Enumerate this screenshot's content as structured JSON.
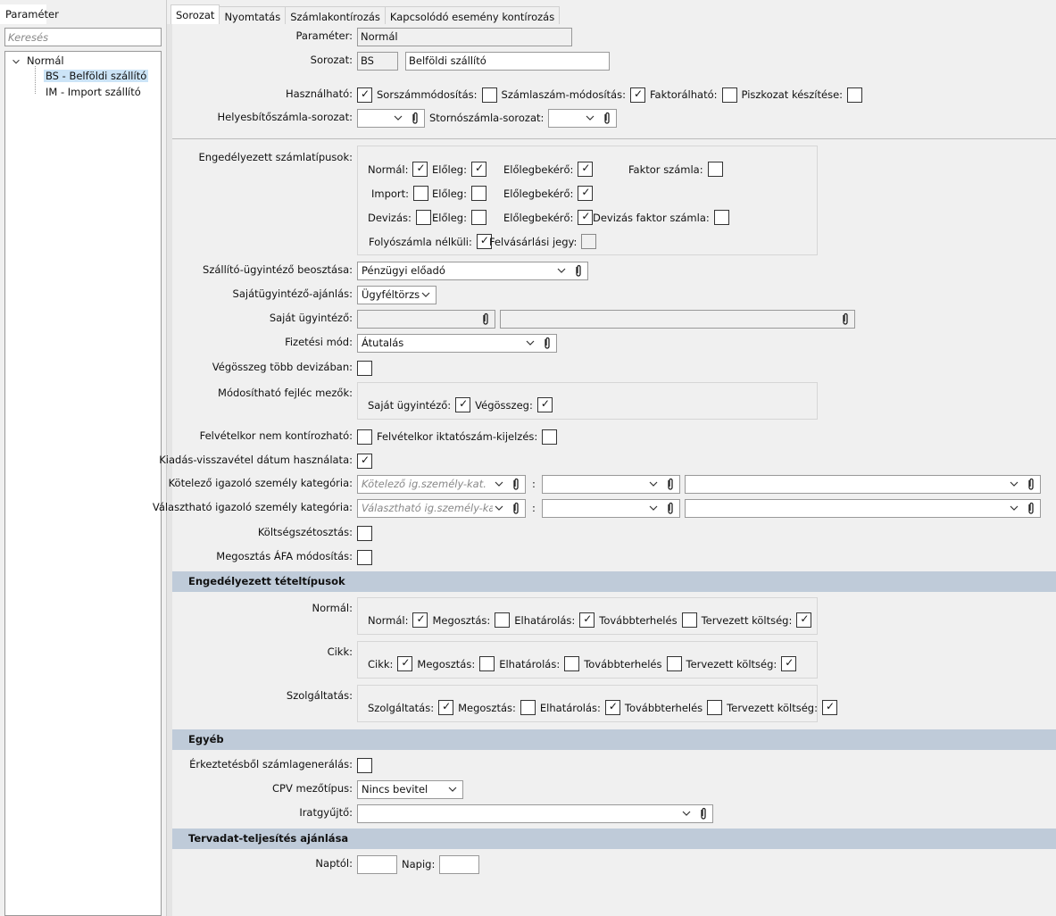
{
  "left": {
    "tab": "Paraméter",
    "search_placeholder": "Keresés",
    "tree": {
      "root": "Normál",
      "items": [
        "BS - Belföldi szállító",
        "IM - Import szállító"
      ]
    }
  },
  "tabs": [
    "Sorozat",
    "Nyomtatás",
    "Számlakontírozás",
    "Kapcsolódó esemény kontírozás"
  ],
  "form": {
    "parameter": {
      "label": "Paraméter:",
      "value": "Normál"
    },
    "sorozat": {
      "label": "Sorozat:",
      "code": "BS",
      "name": "Belföldi szállító"
    },
    "flags": {
      "label": "Használható:",
      "hasznalhato": true,
      "sorszam_label": "Sorszámmódosítás:",
      "sorszam": false,
      "szamlaszam_label": "Számlaszám-módosítás:",
      "szamlaszam": true,
      "faktor_label": "Faktorálható:",
      "faktor": false,
      "piszkozat_label": "Piszkozat készítése:",
      "piszkozat": false
    },
    "helyesbito": {
      "label": "Helyesbítőszámla-sorozat:",
      "value": "",
      "storno_label": "Stornószámla-sorozat:",
      "storno": ""
    },
    "szamlatipusok": {
      "label": "Engedélyezett számlatípusok:",
      "normal_label": "Normál:",
      "normal": true,
      "normal_eloleg_label": "Előleg:",
      "normal_eloleg": true,
      "normal_bekero_label": "Előlegbekérő:",
      "normal_bekero": true,
      "faktor_label": "Faktor számla:",
      "faktor": false,
      "import_label": "Import:",
      "import": false,
      "import_eloleg_label": "Előleg:",
      "import_eloleg": false,
      "import_bekero_label": "Előlegbekérő:",
      "import_bekero": true,
      "devizas_label": "Devizás:",
      "devizas": false,
      "devizas_eloleg_label": "Előleg:",
      "devizas_eloleg": false,
      "devizas_bekero_label": "Előlegbekérő:",
      "devizas_bekero": true,
      "devizas_faktor_label": "Devizás faktor számla:",
      "devizas_faktor": false,
      "folyo_label": "Folyószámla nélküli:",
      "folyo": true,
      "felvasarlasi_label": "Felvásárlási jegy:",
      "felvasarlasi": false
    },
    "beosztas": {
      "label": "Szállító-ügyintéző beosztása:",
      "value": "Pénzügyi előadó"
    },
    "ajanlas": {
      "label": "Sajátügyintéző-ajánlás:",
      "value": "Ügyféltörzs"
    },
    "sajat": {
      "label": "Saját ügyintéző:",
      "value": "",
      "name": ""
    },
    "fizetesi": {
      "label": "Fizetési mód:",
      "value": "Átutalás"
    },
    "vegosszeg": {
      "label": "Végösszeg több devizában:",
      "value": false
    },
    "modosithato": {
      "label": "Módosítható fejléc mezők:",
      "sajat_label": "Saját ügyintéző:",
      "sajat": true,
      "vegosszeg_label": "Végösszeg:",
      "vegosszeg": true
    },
    "felvetel": {
      "label": "Felvételkor nem kontírozható:",
      "value": false,
      "iktato_label": "Felvételkor iktatószám-kijelzés:",
      "iktato": false
    },
    "kiadas": {
      "label": "Kiadás-visszavétel dátum használata:",
      "value": true
    },
    "kotelezo": {
      "label": "Kötelező igazoló személy kategória:",
      "placeholder": "Kötelező ig.személy-kat.",
      "sep": ":"
    },
    "valaszthato": {
      "label": "Választható igazoló személy kategória:",
      "placeholder": "Választható ig.személy-kat.",
      "sep": ":"
    },
    "koltseg": {
      "label": "Költségszétosztás:",
      "value": false
    },
    "megosztas_afa": {
      "label": "Megosztás ÁFA módosítás:",
      "value": false
    }
  },
  "tetel": {
    "header": "Engedélyezett tételtípusok",
    "normal": {
      "label": "Normál:",
      "items": [
        {
          "label": "Normál:",
          "value": true
        },
        {
          "label": "Megosztás:",
          "value": false
        },
        {
          "label": "Elhatárolás:",
          "value": true
        },
        {
          "label": "Továbbterhelés",
          "value": false
        },
        {
          "label": "Tervezett költség:",
          "value": true
        }
      ]
    },
    "cikk": {
      "label": "Cikk:",
      "items": [
        {
          "label": "Cikk:",
          "value": true
        },
        {
          "label": "Megosztás:",
          "value": false
        },
        {
          "label": "Elhatárolás:",
          "value": false
        },
        {
          "label": "Továbbterhelés",
          "value": false
        },
        {
          "label": "Tervezett költség:",
          "value": true
        }
      ]
    },
    "szolg": {
      "label": "Szolgáltatás:",
      "items": [
        {
          "label": "Szolgáltatás:",
          "value": true
        },
        {
          "label": "Megosztás:",
          "value": false
        },
        {
          "label": "Elhatárolás:",
          "value": true
        },
        {
          "label": "Továbbterhelés",
          "value": false
        },
        {
          "label": "Tervezett költség:",
          "value": true
        }
      ]
    }
  },
  "egyeb": {
    "header": "Egyéb",
    "erkeztetes": {
      "label": "Érkeztetésből számlagenerálás:",
      "value": false
    },
    "cpv": {
      "label": "CPV mezőtípus:",
      "value": "Nincs bevitel"
    },
    "iratgyujto": {
      "label": "Iratgyűjtő:",
      "value": ""
    }
  },
  "tervadat": {
    "header": "Tervadat-teljesítés ajánlása",
    "naptol": {
      "label": "Naptól:",
      "value": ""
    },
    "napig": {
      "label": "Napig:",
      "value": ""
    }
  }
}
